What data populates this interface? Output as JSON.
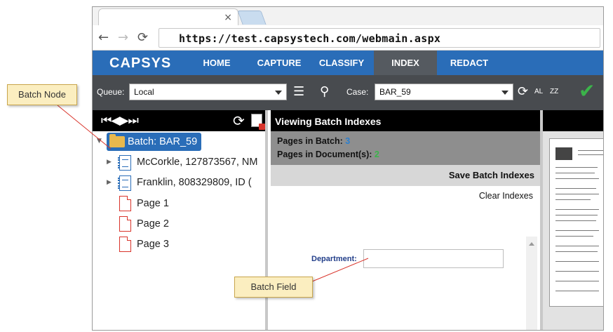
{
  "browser": {
    "tab_close": "×",
    "url": "https://test.capsystech.com/webmain.aspx",
    "back_glyph": "←",
    "forward_glyph": "→",
    "reload_glyph": "⟳"
  },
  "app": {
    "brand": "CAPSYS",
    "nav": [
      {
        "label": "HOME",
        "active": false
      },
      {
        "label": "CAPTURE",
        "active": false
      },
      {
        "label": "CLASSIFY",
        "active": false
      },
      {
        "label": "INDEX",
        "active": true
      },
      {
        "label": "REDACT",
        "active": false
      }
    ],
    "accent_color": "#2a6db8"
  },
  "controls": {
    "queue_label": "Queue:",
    "queue_value": "Local",
    "case_label": "Case:",
    "case_value": "BAR_59",
    "al_label": "AL",
    "zz_label": "ZZ",
    "icons": [
      "list-icon",
      "search-icon",
      "refresh-icon",
      "check-icon"
    ]
  },
  "left_panel": {
    "nav_glyphs": "⏮◀▶⏭",
    "tree": {
      "batch": "Batch: BAR_59",
      "documents": [
        "McCorkle, 127873567, NM",
        "Franklin, 808329809, ID ("
      ],
      "pages": [
        "Page 1",
        "Page 2",
        "Page 3"
      ]
    }
  },
  "center_panel": {
    "title": "Viewing Batch Indexes",
    "pages_in_batch_label": "Pages in Batch:",
    "pages_in_batch_value": "3",
    "pages_in_documents_label": "Pages in Document(s):",
    "pages_in_documents_value": "2",
    "save_label": "Save Batch Indexes",
    "clear_label": "Clear Indexes",
    "department_label": "Department:",
    "department_value": ""
  },
  "callouts": {
    "batch_node": "Batch Node",
    "batch_field": "Batch Field"
  }
}
